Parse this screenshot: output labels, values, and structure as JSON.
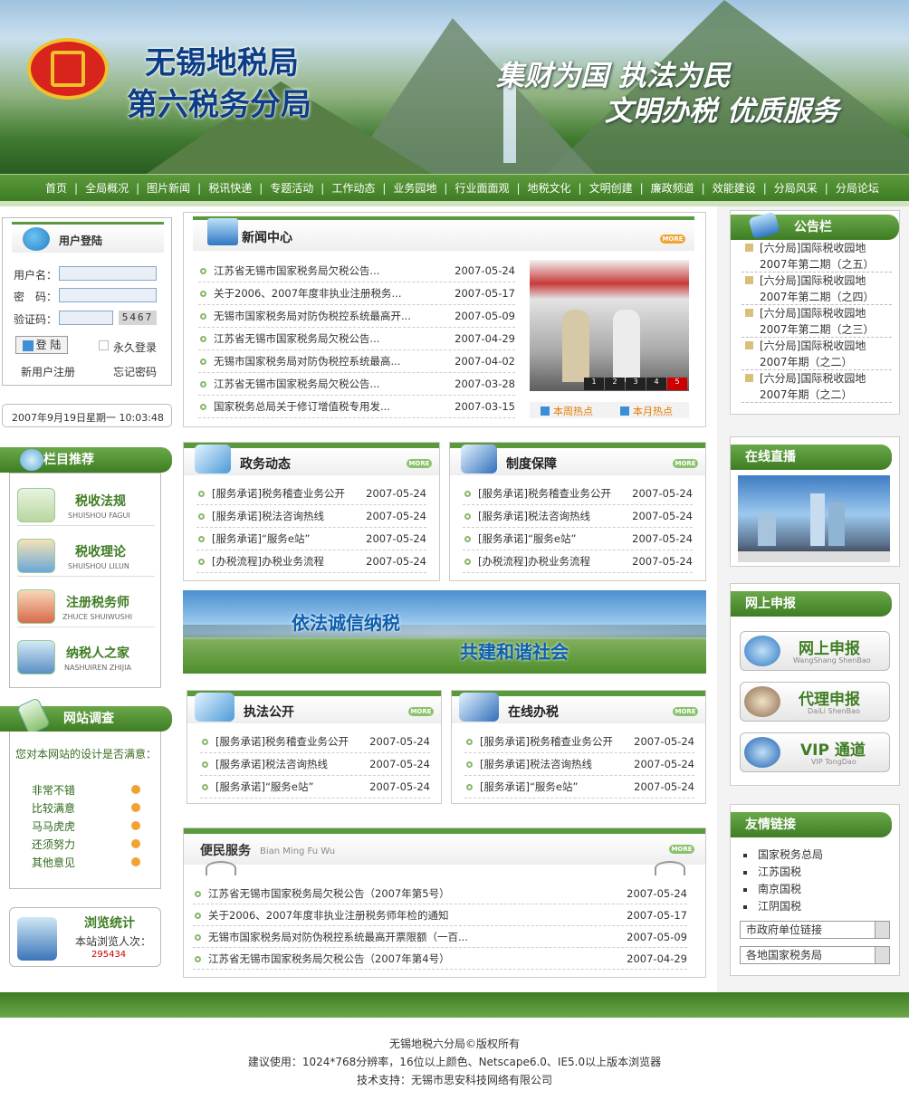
{
  "header": {
    "org_line1": "无锡地税局",
    "org_line2": "第六税务分局",
    "slogan1": "集财为国 执法为民",
    "slogan2": "文明办税 优质服务"
  },
  "nav": [
    "首页",
    "全局概况",
    "图片新闻",
    "税讯快递",
    "专题活动",
    "工作动态",
    "业务园地",
    "行业面面观",
    "地税文化",
    "文明创建",
    "廉政频道",
    "效能建设",
    "分局风采",
    "分局论坛"
  ],
  "login": {
    "title": "用户登陆",
    "username_label": "用户名：",
    "password_label": "密　码：",
    "captcha_label": "验证码：",
    "captcha_code": "5467",
    "login_btn": "登 陆",
    "remember": "永久登录",
    "register": "新用户注册",
    "forgot": "忘记密码",
    "datetime": "2007年9月19日星期一 10:03:48"
  },
  "recommend": {
    "title": "栏目推荐",
    "items": [
      {
        "cn": "税收法规",
        "en": "SHUISHOU FAGUI"
      },
      {
        "cn": "税收理论",
        "en": "SHUISHOU LILUN"
      },
      {
        "cn": "注册税务师",
        "en": "ZHUCE SHUIWUSHI"
      },
      {
        "cn": "纳税人之家",
        "en": "NASHUIREN ZHIJIA"
      }
    ]
  },
  "survey": {
    "title": "网站调查",
    "question": "您对本网站的设计是否满意：",
    "options": [
      "非常不错",
      "比较满意",
      "马马虎虎",
      "还须努力",
      "其他意见"
    ]
  },
  "stats": {
    "title": "浏览统计",
    "label": "本站浏览人次：",
    "count": "295434"
  },
  "news": {
    "title": "新闻中心",
    "more": "MORE",
    "items": [
      {
        "t": "江苏省无锡市国家税务局欠税公告...",
        "d": "2007-05-24"
      },
      {
        "t": "关于2006、2007年度非执业注册税务...",
        "d": "2007-05-17"
      },
      {
        "t": "无锡市国家税务局对防伪税控系统最高开...",
        "d": "2007-05-09"
      },
      {
        "t": "江苏省无锡市国家税务局欠税公告...",
        "d": "2007-04-29"
      },
      {
        "t": "无锡市国家税务局对防伪税控系统最高...",
        "d": "2007-04-02"
      },
      {
        "t": "江苏省无锡市国家税务局欠税公告...",
        "d": "2007-03-28"
      },
      {
        "t": "国家税务总局关于修订增值税专用发...",
        "d": "2007-03-15"
      }
    ],
    "slide_nums": [
      "1",
      "2",
      "3",
      "4",
      "5"
    ],
    "hot_week": "本周热点",
    "hot_month": "本月热点"
  },
  "zhengwu": {
    "title": "政务动态",
    "more": "MORE",
    "items": [
      {
        "t": "[服务承诺]税务稽查业务公开",
        "d": "2007-05-24"
      },
      {
        "t": "[服务承诺]税法咨询热线",
        "d": "2007-05-24"
      },
      {
        "t": "[服务承诺]“服务e站”",
        "d": "2007-05-24"
      },
      {
        "t": "[办税流程]办税业务流程",
        "d": "2007-05-24"
      }
    ]
  },
  "zhidu": {
    "title": "制度保障",
    "more": "MORE",
    "items": [
      {
        "t": "[服务承诺]税务稽查业务公开",
        "d": "2007-05-24"
      },
      {
        "t": "[服务承诺]税法咨询热线",
        "d": "2007-05-24"
      },
      {
        "t": "[服务承诺]“服务e站”",
        "d": "2007-05-24"
      },
      {
        "t": "[办税流程]办税业务流程",
        "d": "2007-05-24"
      }
    ]
  },
  "banner": {
    "line1": "依法诚信纳税",
    "line2": "共建和谐社会"
  },
  "zhifa": {
    "title": "执法公开",
    "more": "MORE",
    "items": [
      {
        "t": "[服务承诺]税务稽查业务公开",
        "d": "2007-05-24"
      },
      {
        "t": "[服务承诺]税法咨询热线",
        "d": "2007-05-24"
      },
      {
        "t": "[服务承诺]“服务e站”",
        "d": "2007-05-24"
      }
    ]
  },
  "zaixian": {
    "title": "在线办税",
    "more": "MORE",
    "items": [
      {
        "t": "[服务承诺]税务稽查业务公开",
        "d": "2007-05-24"
      },
      {
        "t": "[服务承诺]税法咨询热线",
        "d": "2007-05-24"
      },
      {
        "t": "[服务承诺]“服务e站”",
        "d": "2007-05-24"
      }
    ]
  },
  "bianmin": {
    "title": "便民服务",
    "pinyin": "Bian Ming Fu Wu",
    "more": "MORE",
    "items": [
      {
        "t": "江苏省无锡市国家税务局欠税公告（2007年第5号）",
        "d": "2007-05-24"
      },
      {
        "t": "关于2006、2007年度非执业注册税务师年检的通知",
        "d": "2007-05-17"
      },
      {
        "t": "无锡市国家税务局对防伪税控系统最高开票限额（一百...",
        "d": "2007-05-09"
      },
      {
        "t": "江苏省无锡市国家税务局欠税公告（2007年第4号）",
        "d": "2007-04-29"
      }
    ]
  },
  "notice": {
    "title": "公告栏",
    "items": [
      [
        "[六分局]国际税收园地",
        "2007年第二期（之五）"
      ],
      [
        "[六分局]国际税收园地",
        "2007年第二期（之四）"
      ],
      [
        "[六分局]国际税收园地",
        "2007年第二期（之三）"
      ],
      [
        "[六分局]国际税收园地",
        "2007年期（之二）"
      ],
      [
        "[六分局]国际税收园地",
        "2007年期（之二）"
      ]
    ]
  },
  "live": {
    "title": "在线直播"
  },
  "declare": {
    "title": "网上申报",
    "items": [
      {
        "cn": "网上申报",
        "en": "WangShang ShenBao"
      },
      {
        "cn": "代理申报",
        "en": "DaiLi ShenBao"
      },
      {
        "cn": "VIP 通道",
        "en": "VIP TongDao"
      }
    ]
  },
  "links": {
    "title": "友情链接",
    "items": [
      "国家税务总局",
      "江苏国税",
      "南京国税",
      "江阴国税"
    ],
    "select1": "市政府单位链接",
    "select2": "各地国家税务局"
  },
  "footer": {
    "line1": "无锡地税六分局©版权所有",
    "line2": "建议使用：1024*768分辨率，16位以上颜色、Netscape6.0、IE5.0以上版本浏览器",
    "line3": "技术支持：无锡市思安科技网络有限公司"
  },
  "colors": {
    "green": "#5a9a3c",
    "dark_green": "#3f7d24",
    "red": "#d8241c",
    "navy": "#0c3d86"
  }
}
